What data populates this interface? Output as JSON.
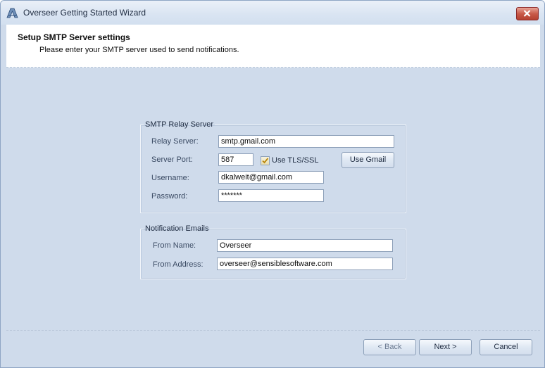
{
  "window": {
    "title": "Overseer Getting Started Wizard"
  },
  "header": {
    "title": "Setup SMTP Server settings",
    "subtitle": "Please enter your SMTP server used to send notifications."
  },
  "smtp_group": {
    "legend": "SMTP Relay Server",
    "relay_server_label": "Relay Server:",
    "relay_server_value": "smtp.gmail.com",
    "server_port_label": "Server Port:",
    "server_port_value": "587",
    "use_tls_label": "Use TLS/SSL",
    "use_tls_checked": true,
    "use_gmail_label": "Use Gmail",
    "username_label": "Username:",
    "username_value": "dkalweit@gmail.com",
    "password_label": "Password:",
    "password_value": "*******"
  },
  "notification_group": {
    "legend": "Notification Emails",
    "from_name_label": "From Name:",
    "from_name_value": "Overseer",
    "from_address_label": "From Address:",
    "from_address_value": "overseer@sensiblesoftware.com"
  },
  "footer": {
    "back_label": "< Back",
    "next_label": "Next >",
    "cancel_label": "Cancel"
  },
  "colors": {
    "background": "#cfdbeb",
    "close_button": "#c85a49"
  },
  "icons": {
    "app": "overseer-app-icon",
    "close": "close-icon",
    "checkbox": "checkmark-icon"
  }
}
